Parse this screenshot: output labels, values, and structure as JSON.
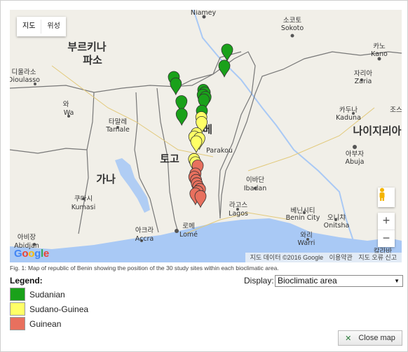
{
  "map": {
    "tabs": [
      {
        "label": "지도",
        "active": true
      },
      {
        "label": "위성",
        "active": false
      }
    ],
    "country_labels": [
      {
        "text": "부르키나"
      },
      {
        "text": "파소"
      },
      {
        "text": "가나"
      },
      {
        "text": "토고"
      },
      {
        "text": "베"
      },
      {
        "text": "나이지리아"
      }
    ],
    "city_labels": [
      {
        "text": "Niamey"
      },
      {
        "text": "소코토"
      },
      {
        "text": "Sokoto"
      },
      {
        "text": "카노"
      },
      {
        "text": "Kano"
      },
      {
        "text": "디울라소"
      },
      {
        "text": "Dioulasso"
      },
      {
        "text": "와"
      },
      {
        "text": "Wa"
      },
      {
        "text": "타말레"
      },
      {
        "text": "Tamale"
      },
      {
        "text": "자리아"
      },
      {
        "text": "Zaria"
      },
      {
        "text": "카두나"
      },
      {
        "text": "Kaduna"
      },
      {
        "text": "조스"
      },
      {
        "text": "아부자"
      },
      {
        "text": "Abuja"
      },
      {
        "text": "쿠마시"
      },
      {
        "text": "Kumasi"
      },
      {
        "text": "아크라"
      },
      {
        "text": "Accra"
      },
      {
        "text": "로메"
      },
      {
        "text": "Lomé"
      },
      {
        "text": "이바단"
      },
      {
        "text": "Ibadan"
      },
      {
        "text": "라고스"
      },
      {
        "text": "Lagos"
      },
      {
        "text": "베닌시티"
      },
      {
        "text": "Benin City"
      },
      {
        "text": "오니챠"
      },
      {
        "text": "Onitsha"
      },
      {
        "text": "와리"
      },
      {
        "text": "Warri"
      },
      {
        "text": "아비장"
      },
      {
        "text": "Abidjan"
      },
      {
        "text": "칼라바"
      },
      {
        "text": "Parakou"
      }
    ],
    "attribution": [
      "지도 데이터 ©2016 Google",
      "이용약관",
      "지도 오류 신고"
    ],
    "google_logo": "Google",
    "zoom_in": "+",
    "zoom_out": "−"
  },
  "markers": [
    {
      "lat": 11.45,
      "lon": 3.55,
      "zone": "Sudanian"
    },
    {
      "lat": 10.95,
      "lon": 3.45,
      "zone": "Sudanian"
    },
    {
      "lat": 10.6,
      "lon": 1.65,
      "zone": "Sudanian"
    },
    {
      "lat": 10.4,
      "lon": 1.72,
      "zone": "Sudanian"
    },
    {
      "lat": 10.2,
      "lon": 2.7,
      "zone": "Sudanian"
    },
    {
      "lat": 10.12,
      "lon": 2.75,
      "zone": "Sudanian"
    },
    {
      "lat": 10.05,
      "lon": 2.68,
      "zone": "Sudanian"
    },
    {
      "lat": 9.98,
      "lon": 2.78,
      "zone": "Sudanian"
    },
    {
      "lat": 9.9,
      "lon": 2.72,
      "zone": "Sudanian"
    },
    {
      "lat": 9.85,
      "lon": 1.92,
      "zone": "Sudanian"
    },
    {
      "lat": 9.55,
      "lon": 2.65,
      "zone": "Sudanian"
    },
    {
      "lat": 9.45,
      "lon": 1.93,
      "zone": "Sudanian"
    },
    {
      "lat": 9.35,
      "lon": 2.63,
      "zone": "Sudano-Guinea"
    },
    {
      "lat": 9.2,
      "lon": 2.64,
      "zone": "Sudano-Guinea"
    },
    {
      "lat": 8.85,
      "lon": 2.46,
      "zone": "Sudano-Guinea"
    },
    {
      "lat": 8.75,
      "lon": 2.38,
      "zone": "Sudano-Guinea"
    },
    {
      "lat": 8.7,
      "lon": 2.56,
      "zone": "Sudano-Guinea"
    },
    {
      "lat": 8.6,
      "lon": 2.45,
      "zone": "Sudano-Guinea"
    },
    {
      "lat": 8.05,
      "lon": 2.37,
      "zone": "Sudano-Guinea"
    },
    {
      "lat": 7.95,
      "lon": 2.42,
      "zone": "Sudano-Guinea"
    },
    {
      "lat": 7.85,
      "lon": 2.5,
      "zone": "Guinean"
    },
    {
      "lat": 7.6,
      "lon": 2.42,
      "zone": "Guinean"
    },
    {
      "lat": 7.5,
      "lon": 2.38,
      "zone": "Guinean"
    },
    {
      "lat": 7.4,
      "lon": 2.44,
      "zone": "Guinean"
    },
    {
      "lat": 7.3,
      "lon": 2.47,
      "zone": "Guinean"
    },
    {
      "lat": 7.2,
      "lon": 2.52,
      "zone": "Guinean"
    },
    {
      "lat": 7.12,
      "lon": 2.58,
      "zone": "Guinean"
    },
    {
      "lat": 7.05,
      "lon": 2.5,
      "zone": "Guinean"
    },
    {
      "lat": 6.98,
      "lon": 2.42,
      "zone": "Guinean"
    },
    {
      "lat": 6.9,
      "lon": 2.6,
      "zone": "Guinean"
    }
  ],
  "caption": "Fig. 1: Map of republic of Benin showing the position of the 30 study sites within each bioclimatic area.",
  "legend": {
    "title": "Legend:",
    "items": [
      {
        "label": "Sudanian",
        "color": "#1aa11a"
      },
      {
        "label": "Sudano-Guinea",
        "color": "#ffff66"
      },
      {
        "label": "Guinean",
        "color": "#e8705e"
      }
    ]
  },
  "display": {
    "label": "Display:",
    "selected": "Bioclimatic area"
  },
  "close_button": {
    "label": "Close map"
  },
  "colors": {
    "land": "#f1efe8",
    "sea": "#a9c9f5",
    "border": "#666666",
    "marker_sudanian": "#1aa11a",
    "marker_sudano_guinea": "#ffff66",
    "marker_guinean": "#e8705e"
  }
}
